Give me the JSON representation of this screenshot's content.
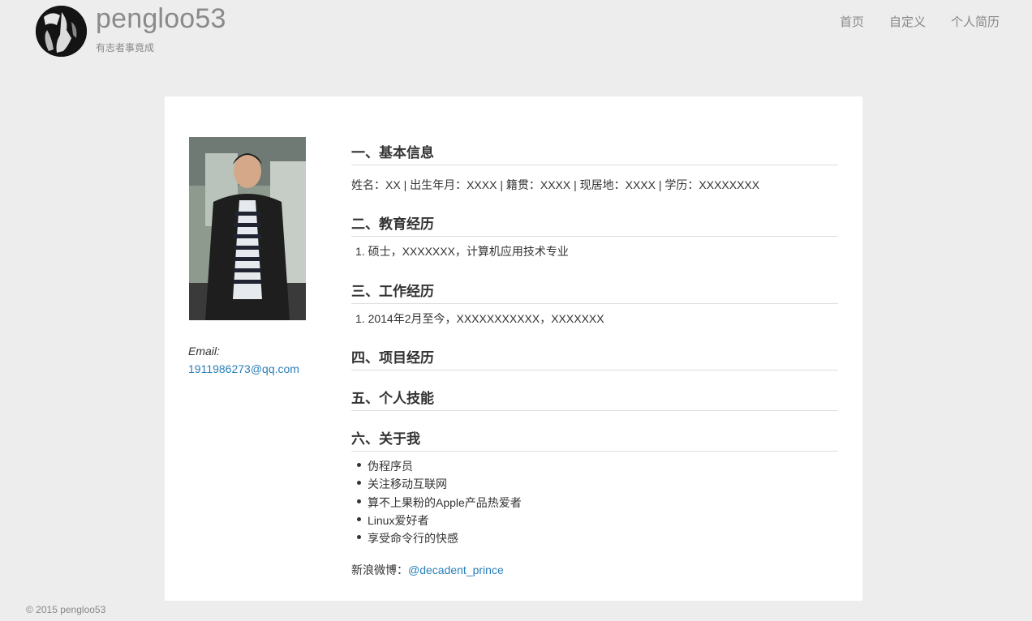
{
  "header": {
    "title": "pengloo53",
    "tagline": "有志者事竟成",
    "nav": [
      "首页",
      "自定义",
      "个人简历"
    ]
  },
  "sidebar": {
    "email_label": "Email:",
    "email": "1911986273@qq.com"
  },
  "sections": {
    "s1": {
      "title": "一、基本信息",
      "text": "姓名：XX | 出生年月：XXXX | 籍贯：XXXX | 现居地：XXXX | 学历：XXXXXXXX"
    },
    "s2": {
      "title": "二、教育经历",
      "item": "1. 硕士，XXXXXXX，计算机应用技术专业"
    },
    "s3": {
      "title": "三、工作经历",
      "item": "1. 2014年2月至今，XXXXXXXXXXX，XXXXXXX"
    },
    "s4": {
      "title": "四、项目经历"
    },
    "s5": {
      "title": "五、个人技能"
    },
    "s6": {
      "title": "六、关于我",
      "items": [
        "伪程序员",
        "关注移动互联网",
        "算不上果粉的Apple产品热爱者",
        "Linux爱好者",
        "享受命令行的快感"
      ]
    },
    "weibo_label": "新浪微博：",
    "weibo_link": "@decadent_prince"
  },
  "footer": {
    "text": "© 2015 pengloo53"
  }
}
